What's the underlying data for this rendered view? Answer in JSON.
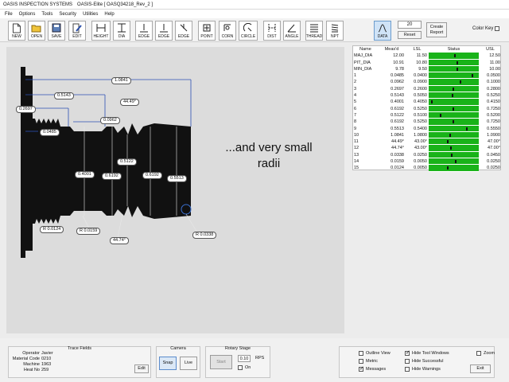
{
  "window": {
    "app_name": "OASIS INSPECTION SYSTEMS",
    "title": "OASIS-Elite  [ OASQ34218_Rev_2 ]"
  },
  "menu": [
    "File",
    "Options",
    "Tools",
    "Security",
    "Utilities",
    "Help"
  ],
  "toolbar": {
    "buttons": [
      {
        "label": "NEW",
        "icon": "new-file-icon"
      },
      {
        "label": "OPEN",
        "icon": "open-folder-icon"
      },
      {
        "label": "SAVE",
        "icon": "save-disk-icon"
      },
      {
        "label": "EDIT",
        "icon": "edit-pencil-icon"
      },
      {
        "label": "HEIGHT",
        "icon": "height-icon"
      },
      {
        "label": "DIA",
        "icon": "diameter-icon"
      },
      {
        "label": "EDGE",
        "icon": "edge-icon"
      },
      {
        "label": "EDGE",
        "icon": "edge-icon"
      },
      {
        "label": "EDGE",
        "icon": "edge-icon"
      },
      {
        "label": "POINT",
        "icon": "point-icon"
      },
      {
        "label": "CORN",
        "icon": "corner-icon"
      },
      {
        "label": "CIRCLE",
        "icon": "circle-icon"
      },
      {
        "label": "DIST",
        "icon": "distance-icon"
      },
      {
        "label": "ANGLE",
        "icon": "angle-icon"
      },
      {
        "label": "THREAD",
        "icon": "thread-icon"
      },
      {
        "label": "NPT",
        "icon": "npt-icon"
      }
    ],
    "data_button": "DATA",
    "count_value": "20",
    "reset_label": "Reset",
    "create_report_label": "Create Report",
    "color_key_label": "Color Key"
  },
  "canvas": {
    "overlay_text": "...and very small radii",
    "dimension_labels": [
      "1.0841",
      "0.5143",
      "0.2697",
      "0.0485",
      "44.49°",
      "0.0962",
      "0.4001",
      "0.6192",
      "0.5122",
      "0.6192",
      "0.5513",
      "R 0.0124",
      "R 0.0159",
      "44.74°",
      "R 0.0338"
    ]
  },
  "results_table": {
    "headers": [
      "Name",
      "Meas'd",
      "LSL",
      "Status",
      "USL"
    ],
    "rows": [
      {
        "name": "MAJ_DIA",
        "meas": "12.00",
        "lsl": "11.50",
        "usl": "12.50",
        "pos": 0.5
      },
      {
        "name": "PIT_DIA",
        "meas": "10.91",
        "lsl": "10.80",
        "usl": "11.00",
        "pos": 0.55
      },
      {
        "name": "MIN_DIA",
        "meas": "9.78",
        "lsl": "9.50",
        "usl": "10.00",
        "pos": 0.56
      },
      {
        "name": "1",
        "meas": "0.0485",
        "lsl": "0.0400",
        "usl": "0.0500",
        "pos": 0.85
      },
      {
        "name": "2",
        "meas": "0.0962",
        "lsl": "0.0900",
        "usl": "0.1000",
        "pos": 0.62
      },
      {
        "name": "3",
        "meas": "0.2697",
        "lsl": "0.2600",
        "usl": "0.2800",
        "pos": 0.48
      },
      {
        "name": "4",
        "meas": "0.5143",
        "lsl": "0.5050",
        "usl": "0.5250",
        "pos": 0.46
      },
      {
        "name": "5",
        "meas": "0.4001",
        "lsl": "0.4050",
        "usl": "0.4150",
        "pos": 0.05
      },
      {
        "name": "6",
        "meas": "0.6192",
        "lsl": "0.5250",
        "usl": "0.7250",
        "pos": 0.47
      },
      {
        "name": "7",
        "meas": "0.5122",
        "lsl": "0.5100",
        "usl": "0.5200",
        "pos": 0.22
      },
      {
        "name": "8",
        "meas": "0.6192",
        "lsl": "0.5250",
        "usl": "0.7250",
        "pos": 0.47
      },
      {
        "name": "9",
        "meas": "0.5513",
        "lsl": "0.5400",
        "usl": "0.5550",
        "pos": 0.75
      },
      {
        "name": "10",
        "meas": "1.0841",
        "lsl": "1.0800",
        "usl": "1.0900",
        "pos": 0.41
      },
      {
        "name": "11",
        "meas": "44.49°",
        "lsl": "43.00°",
        "usl": "47.00°",
        "pos": 0.37
      },
      {
        "name": "12",
        "meas": "44.74°",
        "lsl": "43.00°",
        "usl": "47.00°",
        "pos": 0.43
      },
      {
        "name": "13",
        "meas": "0.0338",
        "lsl": "0.0250",
        "usl": "0.0450",
        "pos": 0.44
      },
      {
        "name": "14",
        "meas": "0.0159",
        "lsl": "0.0050",
        "usl": "0.0250",
        "pos": 0.53
      },
      {
        "name": "15",
        "meas": "0.0124",
        "lsl": "0.0050",
        "usl": "0.0250",
        "pos": 0.37
      }
    ]
  },
  "trace_fields": {
    "title": "Trace Fields",
    "fields": [
      {
        "key": "Operator",
        "value": "Javier"
      },
      {
        "key": "Material Code",
        "value": "0210"
      },
      {
        "key": "Machine",
        "value": "1963"
      },
      {
        "key": "Heat No",
        "value": "259"
      }
    ],
    "edit_label": "Edit"
  },
  "camera": {
    "title": "Camera",
    "snap_label": "Snap",
    "live_label": "Live"
  },
  "rotary": {
    "title": "Rotary Stage",
    "start_label": "Start",
    "rps_value": "0.10",
    "rps_unit": "RPS",
    "on_label": "On"
  },
  "options": {
    "outline_view": "Outline View",
    "metric": "Metric",
    "messages": "Messages",
    "hide_tool_windows": "Hide Tool Windows",
    "hide_successful": "Hide Successful",
    "hide_warnings": "Hide Warnings",
    "zoom": "Zoom",
    "exit_label": "Exit"
  },
  "colors": {
    "pass_green": "#19b319",
    "canvas_bg": "#dcdcdc",
    "part_black": "#111111",
    "dimension_blue": "#2b4fb5"
  }
}
